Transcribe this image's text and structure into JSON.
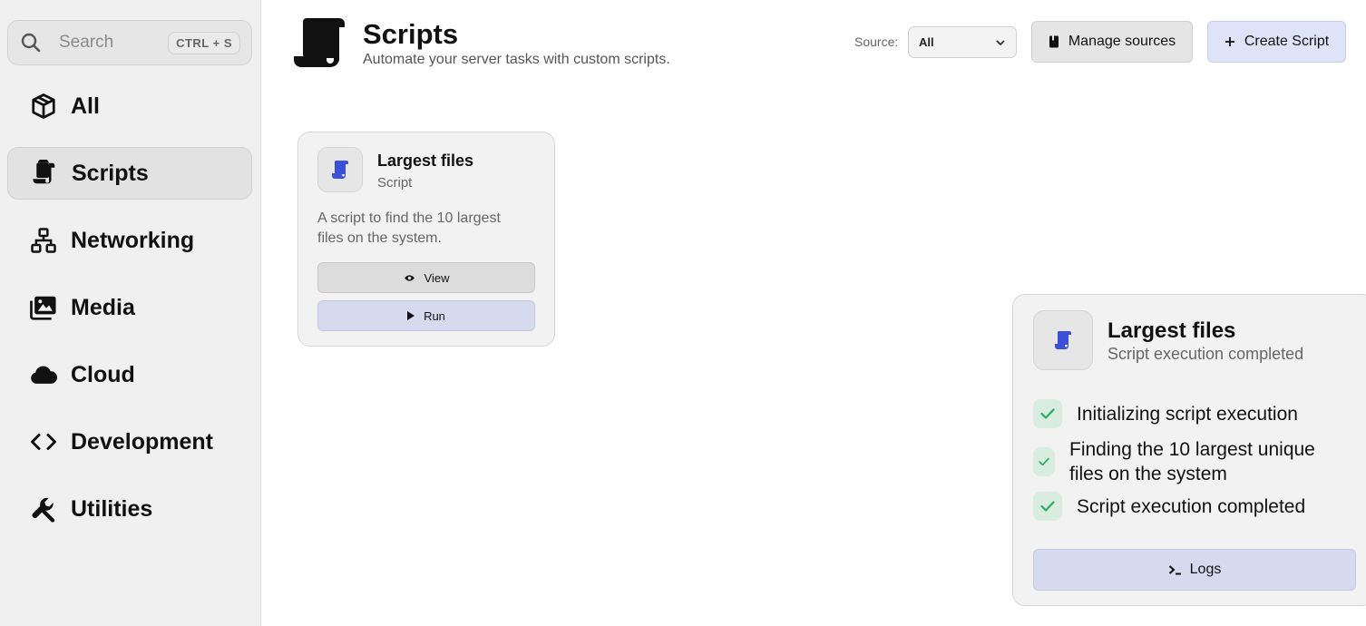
{
  "sidebar": {
    "search": {
      "placeholder": "Search",
      "shortcut": "CTRL + S",
      "icon": "search-icon"
    },
    "items": [
      {
        "label": "All",
        "icon": "cube-icon",
        "active": false
      },
      {
        "label": "Scripts",
        "icon": "scroll-icon",
        "active": true
      },
      {
        "label": "Networking",
        "icon": "network-icon",
        "active": false
      },
      {
        "label": "Media",
        "icon": "images-icon",
        "active": false
      },
      {
        "label": "Cloud",
        "icon": "cloud-icon",
        "active": false
      },
      {
        "label": "Development",
        "icon": "code-icon",
        "active": false
      },
      {
        "label": "Utilities",
        "icon": "wrench-icon",
        "active": false
      }
    ]
  },
  "header": {
    "title": "Scripts",
    "subtitle": "Automate your server tasks with custom scripts.",
    "source_label": "Source:",
    "source_value": "All",
    "manage_label": "Manage sources",
    "create_label": "Create Script"
  },
  "card": {
    "title": "Largest files",
    "type": "Script",
    "description": "A script to find the 10 largest files on the system.",
    "view_label": "View",
    "run_label": "Run"
  },
  "execution": {
    "title": "Largest files",
    "status": "Script execution completed",
    "steps": [
      "Initializing script execution",
      "Finding the 10 largest unique files on the system",
      "Script execution completed"
    ],
    "logs_label": "Logs"
  },
  "colors": {
    "accent_icon": "#3b4fd8",
    "check_green": "#2fa862",
    "primary_btn": "#dfe3f7"
  }
}
